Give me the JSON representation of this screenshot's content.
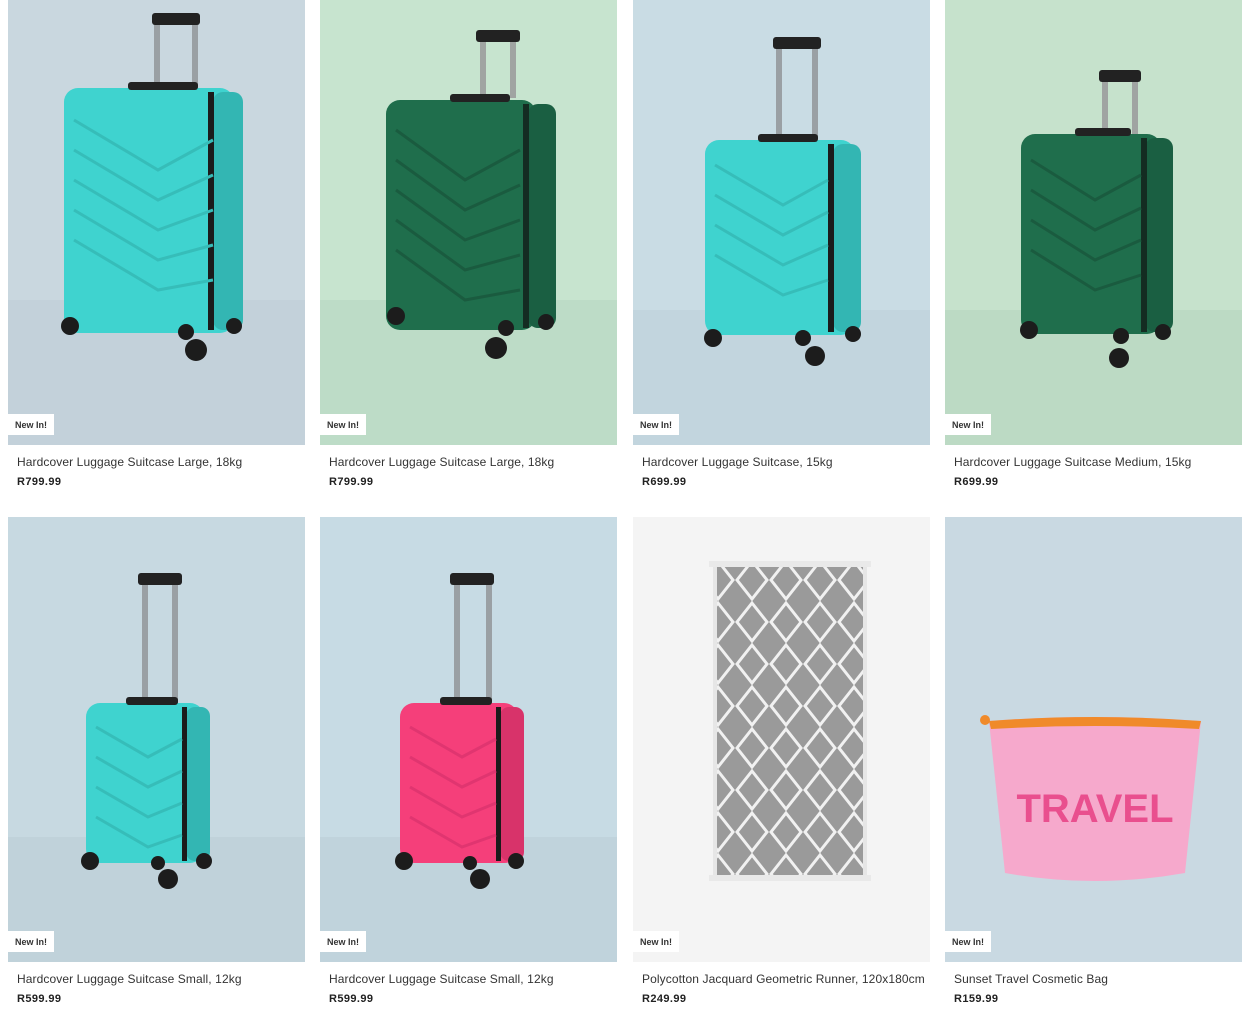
{
  "products": [
    {
      "name": "Hardcover Luggage Suitcase Large, 18kg",
      "price": "R799.99",
      "badge": "New In!",
      "image": "suitcase-large-turquoise",
      "bg": "#c9d7df",
      "color": "#3fd3cf"
    },
    {
      "name": "Hardcover Luggage Suitcase Large, 18kg",
      "price": "R799.99",
      "badge": "New In!",
      "image": "suitcase-large-green",
      "bg": "#c7e4cf",
      "color": "#1f6e4c"
    },
    {
      "name": "Hardcover Luggage Suitcase, 15kg",
      "price": "R699.99",
      "badge": "New In!",
      "image": "suitcase-medium-turquoise",
      "bg": "#c9dce4",
      "color": "#3fd3cf"
    },
    {
      "name": "Hardcover Luggage Suitcase Medium, 15kg",
      "price": "R699.99",
      "badge": "New In!",
      "image": "suitcase-medium-green",
      "bg": "#c6e2cc",
      "color": "#1f6e4c"
    },
    {
      "name": "Hardcover Luggage Suitcase Small, 12kg",
      "price": "R599.99",
      "badge": "New In!",
      "image": "suitcase-small-turquoise",
      "bg": "#c7d9e1",
      "color": "#3fd3cf"
    },
    {
      "name": "Hardcover Luggage Suitcase Small, 12kg",
      "price": "R599.99",
      "badge": "New In!",
      "image": "suitcase-small-pink",
      "bg": "#c7dbe4",
      "color": "#f53f7a"
    },
    {
      "name": "Polycotton Jacquard Geometric Runner, 120x180cm",
      "price": "R249.99",
      "badge": "New In!",
      "image": "geometric-runner-rug",
      "bg": "#f4f4f4",
      "color": "#9a9a9a"
    },
    {
      "name": "Sunset Travel Cosmetic Bag",
      "price": "R159.99",
      "badge": "New In!",
      "image": "travel-cosmetic-bag",
      "bg": "#c9d9e2",
      "color": "#f6a9cc",
      "bag_text": "TRAVEL"
    }
  ]
}
